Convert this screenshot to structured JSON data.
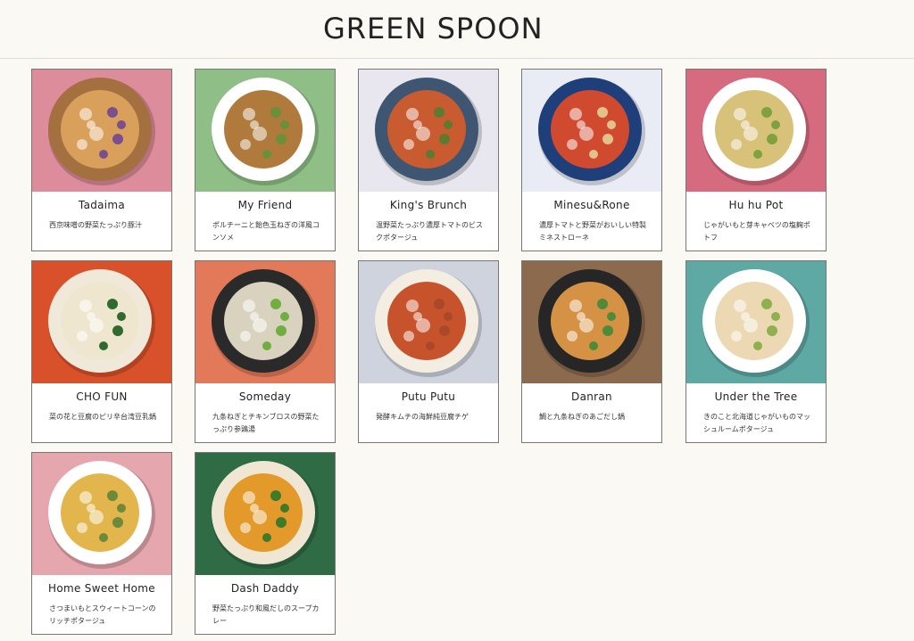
{
  "brand": {
    "logo_text": "GREEN SPOON",
    "colors": {
      "page_bg": "#faf9f3",
      "card_border": "#777777",
      "text": "#222222"
    }
  },
  "products": [
    {
      "name": "Tadaima",
      "desc": "西京味噌の野菜たっぷり豚汁",
      "bg": "#dc8c9a",
      "plate": "#a5703f",
      "soup": "#d9a05b",
      "accent": "#7b4f8d"
    },
    {
      "name": "My Friend",
      "desc": "ポルチーニと飴色玉ねぎの洋風コンソメ",
      "bg": "#8fbf86",
      "plate": "#ffffff",
      "soup": "#b07a3c",
      "accent": "#6b8f3a"
    },
    {
      "name": "King's Brunch",
      "desc": "温野菜たっぷり濃厚トマトのビスクポタージュ",
      "bg": "#e8e6ee",
      "plate": "#3f5673",
      "soup": "#c85b2f",
      "accent": "#5e7a2f"
    },
    {
      "name": "Minesu&Rone",
      "desc": "濃厚トマトと野菜がおいしい特製ミネストローネ",
      "bg": "#e9ecf5",
      "plate": "#1f3f7a",
      "soup": "#cf4a2f",
      "accent": "#e1c28a"
    },
    {
      "name": "Hu hu Pot",
      "desc": "じゃがいもと芽キャベツの塩麹ポトフ",
      "bg": "#d66a7e",
      "plate": "#ffffff",
      "soup": "#d8c27a",
      "accent": "#7fa13f"
    },
    {
      "name": "CHO FUN",
      "desc": "菜の花と豆腐のピリ辛台湾豆乳鍋",
      "bg": "#d9512a",
      "plate": "#f0e8d8",
      "soup": "#efe6cf",
      "accent": "#2f6a2f"
    },
    {
      "name": "Someday",
      "desc": "九条ねぎとチキンブロスの野菜たっぷり参鶏湯",
      "bg": "#e27a5a",
      "plate": "#2a2a2a",
      "soup": "#d8d2bf",
      "accent": "#6fae3f"
    },
    {
      "name": "Putu Putu",
      "desc": "発酵キムチの海鮮純豆腐チゲ",
      "bg": "#cfd3dd",
      "plate": "#f3ede2",
      "soup": "#c7532c",
      "accent": "#a84a2a"
    },
    {
      "name": "Danran",
      "desc": "鯛と九条ねぎのあごだし鍋",
      "bg": "#8b6a4d",
      "plate": "#262626",
      "soup": "#d59245",
      "accent": "#4f8a3a"
    },
    {
      "name": "Under the Tree",
      "desc": "きのこと北海道じゃがいものマッシュルームポタージュ",
      "bg": "#5fa9a5",
      "plate": "#ffffff",
      "soup": "#ecd9b4",
      "accent": "#8fb04f"
    },
    {
      "name": "Home Sweet Home",
      "desc": "さつまいもとスウィートコーンのリッチポタージュ",
      "bg": "#e6a6ad",
      "plate": "#ffffff",
      "soup": "#e2b64c",
      "accent": "#6d8a3a"
    },
    {
      "name": "Dash Daddy",
      "desc": "野菜たっぷり和風だしのスープカレー",
      "bg": "#2f6b45",
      "plate": "#f0e6d4",
      "soup": "#e39a2a",
      "accent": "#3e7a2a"
    }
  ]
}
